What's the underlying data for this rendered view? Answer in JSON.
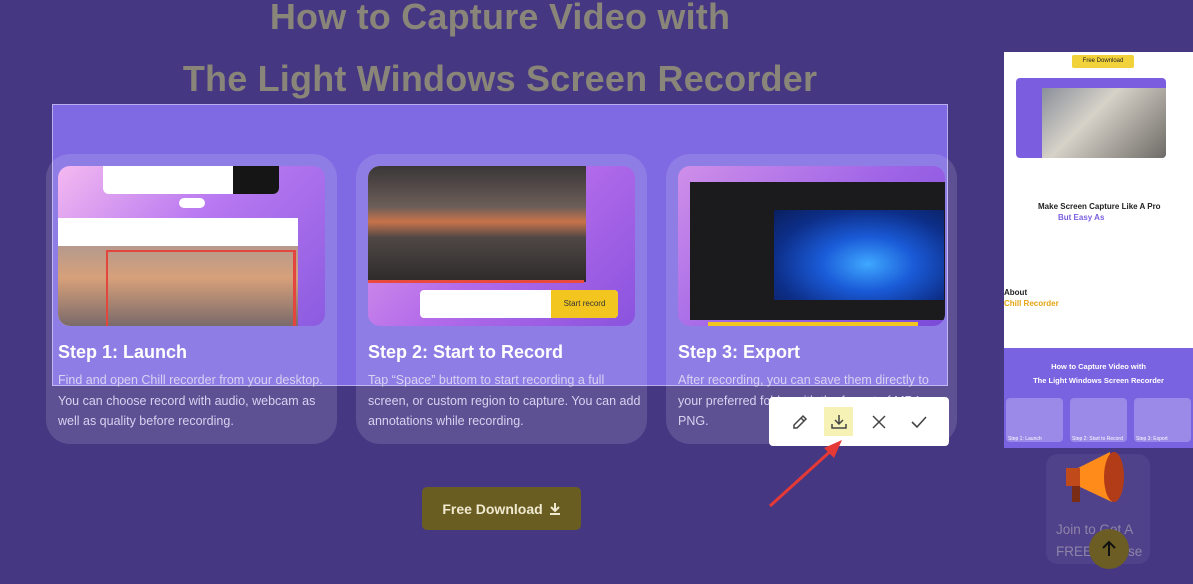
{
  "headline": {
    "line1": "How to Capture Video with",
    "line2": "The Light Windows Screen Recorder"
  },
  "steps": [
    {
      "title": "Step 1: Launch",
      "desc": "Find and open Chill recorder from your desktop. You can choose record with audio, webcam as well as quality before recording."
    },
    {
      "title": "Step 2: Start to Record",
      "desc": "Tap “Space” buttom to start recording a full screen, or custom region to capture. You can add annotations while recording."
    },
    {
      "title": "Step 3: Export",
      "desc": "After recording, you can save them directly to your preferred folder with the format of MP4 or PNG."
    }
  ],
  "step2_start_label": "Start record",
  "toolbar": {
    "edit_icon": "pencil-icon",
    "download_icon": "download-icon",
    "close_icon": "close-icon",
    "confirm_icon": "check-icon"
  },
  "free_download_label": "Free Download",
  "side_preview": {
    "badge": "Free Download",
    "heading1": "Make Screen Capture Like A Pro",
    "heading2": "But Easy As",
    "about": "About",
    "brand": "Chill Recorder",
    "section_title1": "How to Capture Video with",
    "section_title2": "The Light Windows Screen Recorder",
    "thumbs": [
      "Step 1: Launch",
      "Step 2: Start to Record",
      "Step 3: Export"
    ]
  },
  "promo": {
    "line1": "Join to Get A",
    "line2": "FREE License"
  },
  "colors": {
    "page_bg": "#463783",
    "capture_region": "#7f6ae3",
    "accent_yellow": "#f2c61f",
    "annotation_arrow": "#e53935"
  }
}
